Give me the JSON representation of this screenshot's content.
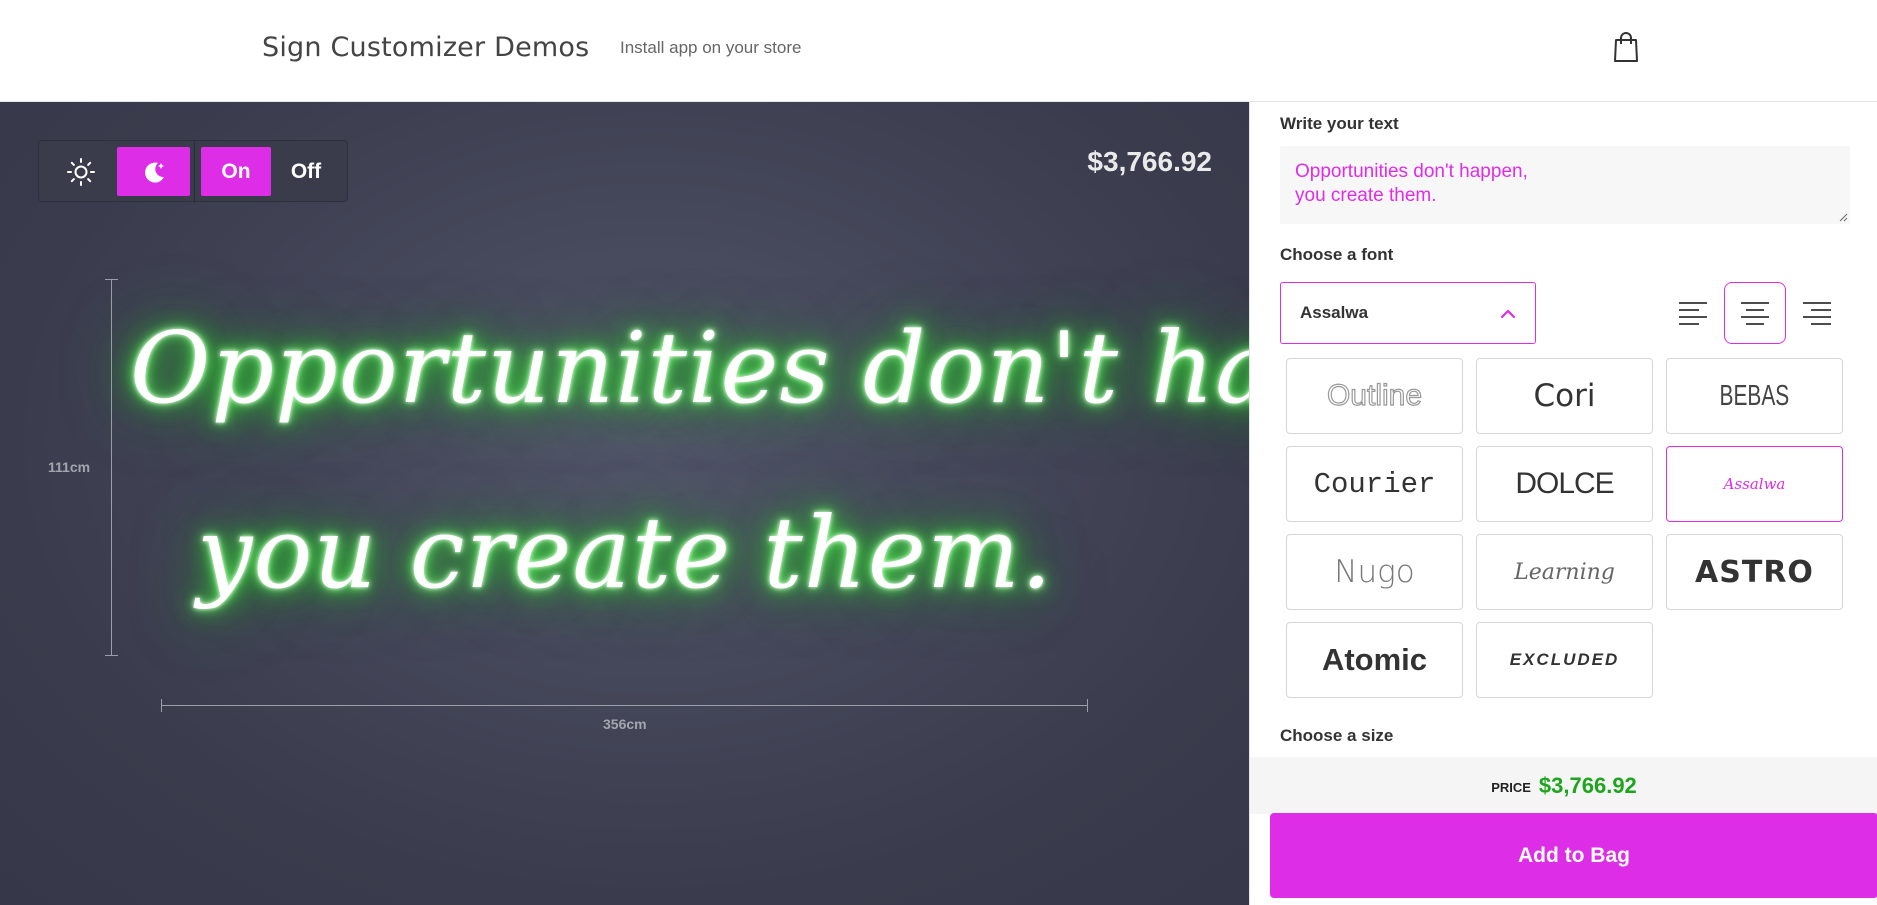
{
  "header": {
    "brand": "Sign Customizer Demos",
    "install_link": "Install app on your store",
    "cart_icon": "shopping-bag-icon"
  },
  "preview": {
    "mode_light_icon": "sun-icon",
    "mode_dark_icon": "moon-icon",
    "on_label": "On",
    "off_label": "Off",
    "price": "$3,766.92",
    "height_label": "111cm",
    "width_label": "356cm",
    "sign_lines": [
      "Opportunities don't happen,",
      "you create them."
    ],
    "glow_color": "#39e539",
    "active_color": "#de2de6"
  },
  "panel": {
    "text_label": "Write your text",
    "text_value": "Opportunities don't happen,\nyou create them.",
    "font_label": "Choose a font",
    "font_selected": "Assalwa",
    "align_options": [
      "align-left-icon",
      "align-center-icon",
      "align-right-icon"
    ],
    "align_selected": "align-center-icon",
    "fonts": [
      {
        "name": "Outline"
      },
      {
        "name": "Cori"
      },
      {
        "name": "BEBAS"
      },
      {
        "name": "Courier"
      },
      {
        "name": "DOLCE"
      },
      {
        "name": "Assalwa"
      },
      {
        "name": "Nugo"
      },
      {
        "name": "Learning"
      },
      {
        "name": "ASTRO"
      },
      {
        "name": "Atomic"
      },
      {
        "name": "EXCLUDED"
      }
    ],
    "size_label": "Choose a size",
    "price_label": "PRICE",
    "price_value": "$3,766.92",
    "price_color": "#1ea51e",
    "add_button": "Add to Bag"
  }
}
